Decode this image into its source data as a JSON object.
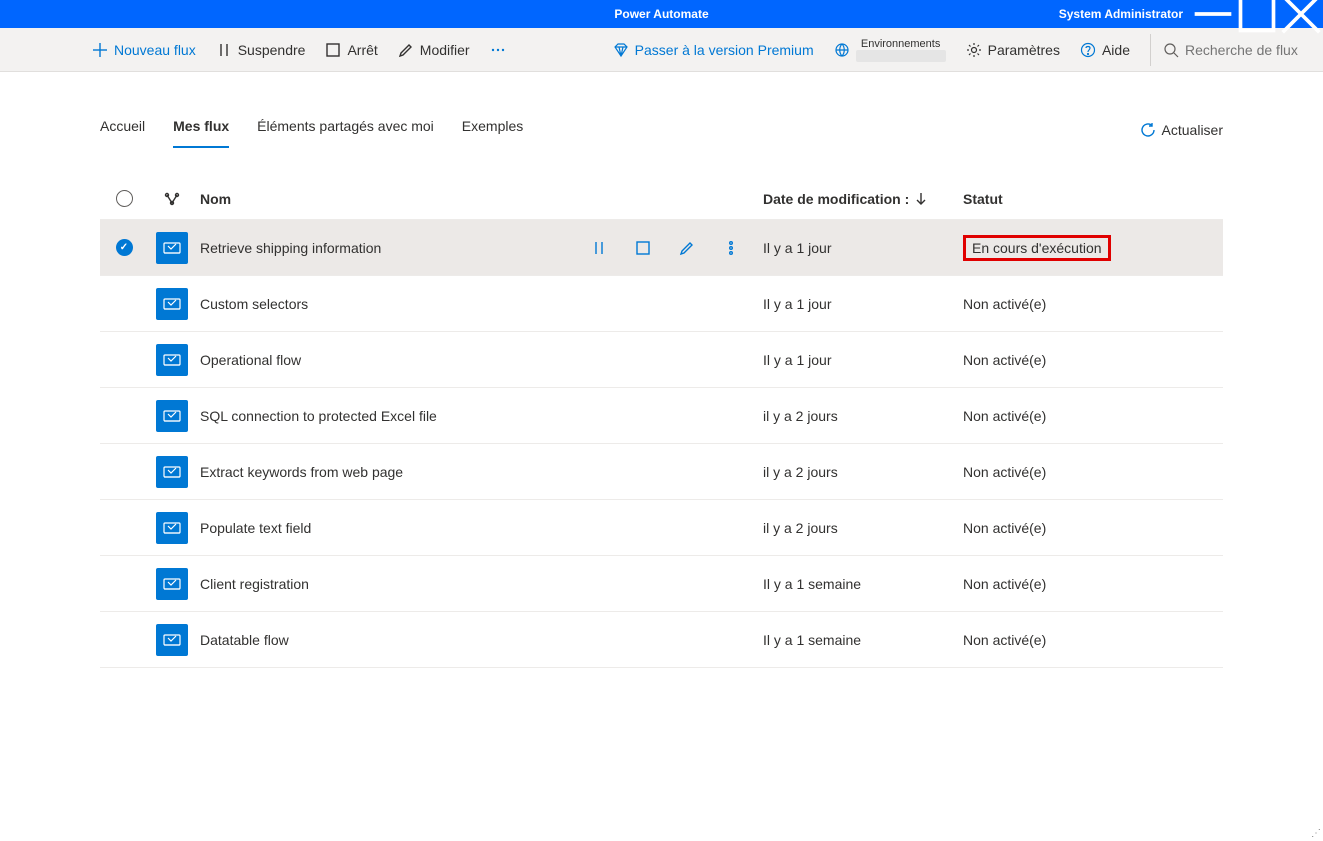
{
  "titlebar": {
    "title": "Power Automate",
    "user": "System Administrator"
  },
  "commandbar": {
    "new_flow": "Nouveau flux",
    "suspend": "Suspendre",
    "stop": "Arrêt",
    "modify": "Modifier",
    "premium": "Passer à la version Premium",
    "environments_label": "Environnements",
    "settings": "Paramètres",
    "help": "Aide",
    "search_placeholder": "Recherche de flux"
  },
  "tabs": {
    "home": "Accueil",
    "my_flows": "Mes flux",
    "shared": "Éléments partagés avec moi",
    "examples": "Exemples",
    "refresh": "Actualiser"
  },
  "columns": {
    "name": "Nom",
    "date": "Date de modification :",
    "status": "Statut"
  },
  "rows": [
    {
      "name": "Retrieve shipping information",
      "date": "Il y a 1 jour",
      "status": "En cours d'exécution",
      "selected": true,
      "highlight": true
    },
    {
      "name": "Custom selectors",
      "date": "Il y a 1 jour",
      "status": "Non activé(e)"
    },
    {
      "name": "Operational flow",
      "date": "Il y a 1 jour",
      "status": "Non activé(e)"
    },
    {
      "name": "SQL connection to protected Excel file",
      "date": "il y a 2 jours",
      "status": "Non activé(e)"
    },
    {
      "name": "Extract keywords from web page",
      "date": "il y a 2 jours",
      "status": "Non activé(e)"
    },
    {
      "name": "Populate text field",
      "date": "il y a 2 jours",
      "status": "Non activé(e)"
    },
    {
      "name": "Client registration",
      "date": "Il y a 1 semaine",
      "status": "Non activé(e)"
    },
    {
      "name": "Datatable flow",
      "date": "Il y a 1 semaine",
      "status": "Non activé(e)"
    }
  ]
}
